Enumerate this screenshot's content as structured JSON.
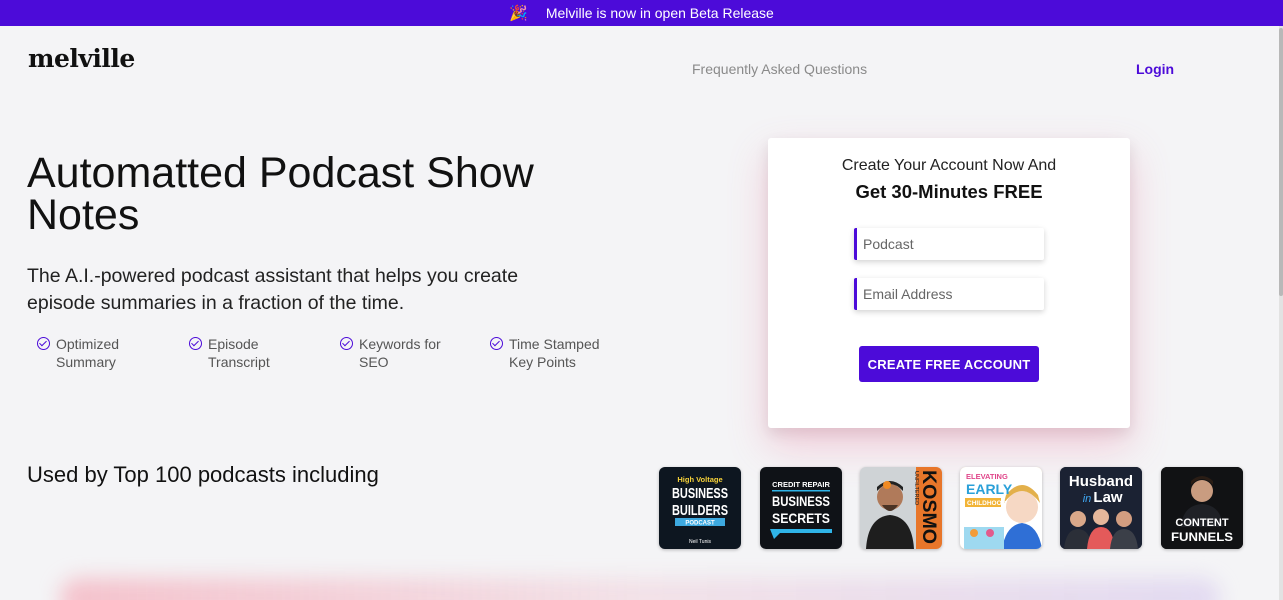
{
  "banner": {
    "icon": "party-popper-icon",
    "text": "Melville is now in open Beta Release"
  },
  "header": {
    "logo": "melville",
    "faq": "Frequently Asked Questions",
    "login": "Login"
  },
  "hero": {
    "title": "Automatted Podcast Show Notes",
    "subtitle": "The A.I.-powered podcast assistant that helps you create episode summaries in a fraction of the time.",
    "features": [
      {
        "label": "Optimized Summary"
      },
      {
        "label": "Episode Transcript"
      },
      {
        "label": "Keywords for SEO"
      },
      {
        "label": "Time Stamped Key Points"
      }
    ]
  },
  "signup": {
    "line1": "Create Your Account Now And",
    "line2": "Get 30-Minutes FREE",
    "podcast_placeholder": "Podcast",
    "email_placeholder": "Email Address",
    "cta": "CREATE FREE ACCOUNT"
  },
  "used_by": "Used by Top 100 podcasts including",
  "podcasts": [
    {
      "line1": "High Voltage",
      "line2": "BUSINESS",
      "line3": "BUILDERS",
      "line4": "PODCAST",
      "line5": "Neil Tunis"
    },
    {
      "line1": "CREDIT REPAIR",
      "line2": "BUSINESS",
      "line3": "SECRETS"
    },
    {
      "line1": "UNFILTERED",
      "line2": "KOSMO"
    },
    {
      "line1": "ELEVATING",
      "line2": "EARLY",
      "line3": "CHILDHOOD"
    },
    {
      "line1": "Husband",
      "line2": "in",
      "line3": "Law"
    },
    {
      "line1": "CONTENT",
      "line2": "FUNNELS"
    }
  ],
  "colors": {
    "brand": "#4c0bd9",
    "background": "#f4f4f6"
  }
}
